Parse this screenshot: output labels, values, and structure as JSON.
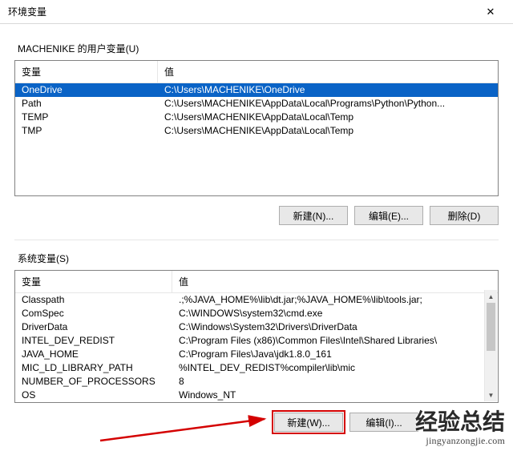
{
  "window": {
    "title": "环境变量"
  },
  "userVars": {
    "groupLabel": "MACHENIKE 的用户变量(U)",
    "headers": {
      "var": "变量",
      "val": "值"
    },
    "rows": [
      {
        "var": "OneDrive",
        "val": "C:\\Users\\MACHENIKE\\OneDrive",
        "selected": true
      },
      {
        "var": "Path",
        "val": "C:\\Users\\MACHENIKE\\AppData\\Local\\Programs\\Python\\Python...",
        "selected": false
      },
      {
        "var": "TEMP",
        "val": "C:\\Users\\MACHENIKE\\AppData\\Local\\Temp",
        "selected": false
      },
      {
        "var": "TMP",
        "val": "C:\\Users\\MACHENIKE\\AppData\\Local\\Temp",
        "selected": false
      }
    ],
    "buttons": {
      "new": "新建(N)...",
      "edit": "编辑(E)...",
      "del": "删除(D)"
    }
  },
  "sysVars": {
    "groupLabel": "系统变量(S)",
    "headers": {
      "var": "变量",
      "val": "值"
    },
    "rows": [
      {
        "var": "Classpath",
        "val": ".;%JAVA_HOME%\\lib\\dt.jar;%JAVA_HOME%\\lib\\tools.jar;"
      },
      {
        "var": "ComSpec",
        "val": "C:\\WINDOWS\\system32\\cmd.exe"
      },
      {
        "var": "DriverData",
        "val": "C:\\Windows\\System32\\Drivers\\DriverData"
      },
      {
        "var": "INTEL_DEV_REDIST",
        "val": "C:\\Program Files (x86)\\Common Files\\Intel\\Shared Libraries\\"
      },
      {
        "var": "JAVA_HOME",
        "val": "C:\\Program Files\\Java\\jdk1.8.0_161"
      },
      {
        "var": "MIC_LD_LIBRARY_PATH",
        "val": "%INTEL_DEV_REDIST%compiler\\lib\\mic"
      },
      {
        "var": "NUMBER_OF_PROCESSORS",
        "val": "8"
      },
      {
        "var": "OS",
        "val": "Windows_NT"
      }
    ],
    "buttons": {
      "new": "新建(W)...",
      "edit": "编辑(I)..."
    }
  },
  "watermark": {
    "big": "经验总结",
    "small": "jingyanzongjie.com"
  }
}
